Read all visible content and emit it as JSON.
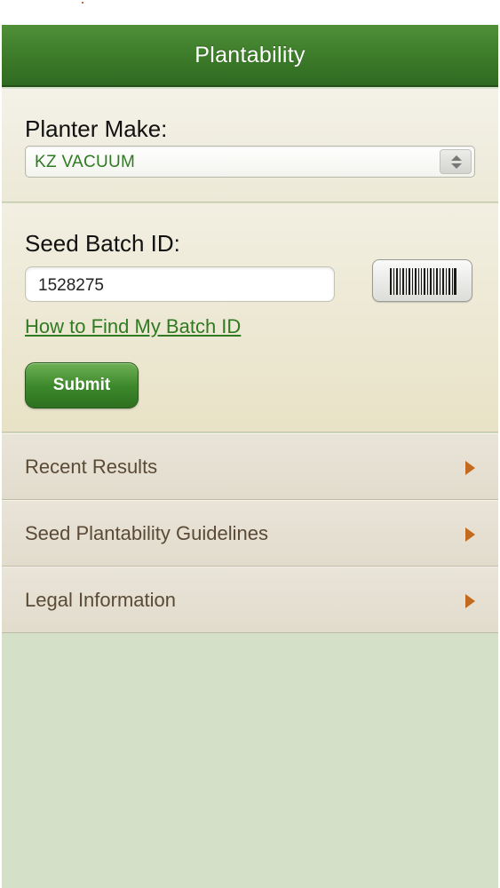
{
  "navbar": {
    "title": "Plantability"
  },
  "planter_make": {
    "label": "Planter Make:",
    "selected_value": "KZ VACUUM"
  },
  "seed_batch": {
    "label": "Seed Batch ID:",
    "input_value": "1528275",
    "scan_icon": "barcode-icon",
    "help_link": "How to Find My Batch ID",
    "submit_label": "Submit"
  },
  "menu": {
    "items": [
      {
        "label": "Recent Results"
      },
      {
        "label": "Seed Plantability Guidelines"
      },
      {
        "label": "Legal Information"
      }
    ]
  },
  "colors": {
    "navbar_green": "#3d7c2a",
    "link_green": "#2f7a22",
    "chevron_orange": "#c26a1f",
    "background_sage": "#d5e0c8"
  }
}
